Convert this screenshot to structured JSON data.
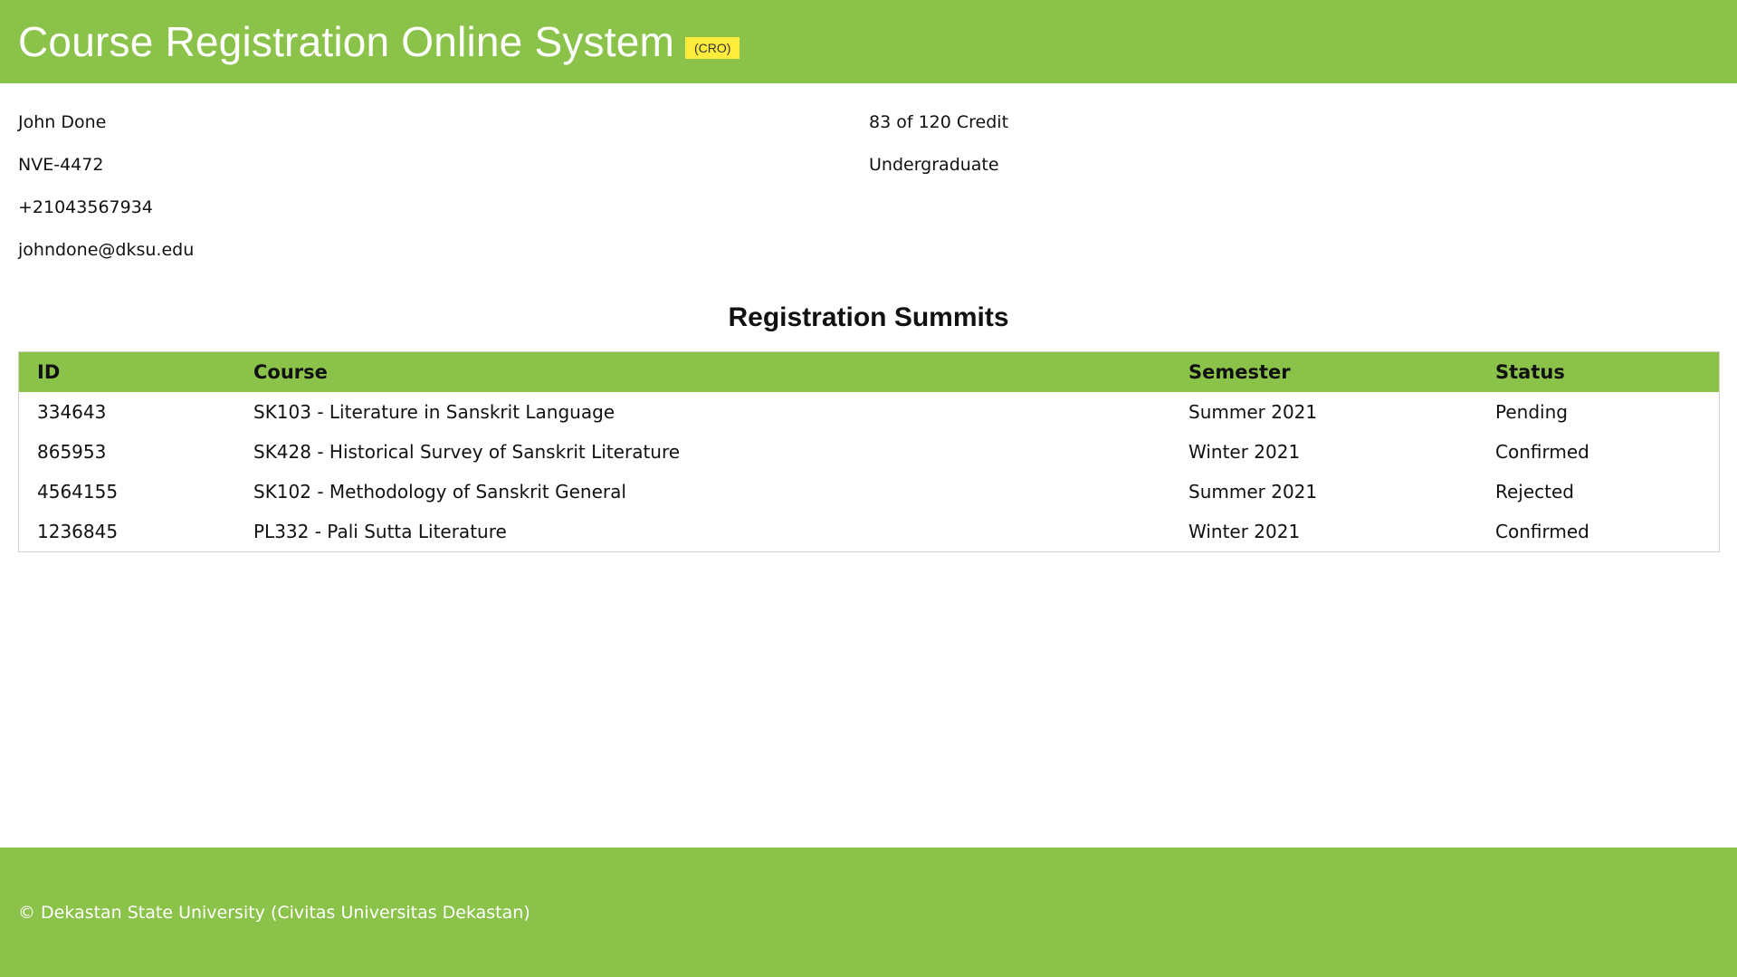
{
  "header": {
    "title": "Course Registration Online System",
    "badge": "(CRO)"
  },
  "student": {
    "name": "John Done",
    "id": "NVE-4472",
    "phone": "+21043567934",
    "email": "johndone@dksu.edu",
    "credit": "83 of 120 Credit",
    "level": "Undergraduate"
  },
  "registrations": {
    "title": "Registration Summits",
    "columns": [
      "ID",
      "Course",
      "Semester",
      "Status"
    ],
    "rows": [
      [
        "334643",
        "SK103 - Literature in Sanskrit Language",
        "Summer 2021",
        "Pending"
      ],
      [
        "865953",
        "SK428 - Historical Survey of Sanskrit Literature",
        "Winter 2021",
        "Confirmed"
      ],
      [
        "4564155",
        "SK102 - Methodology of Sanskrit General",
        "Summer 2021",
        "Rejected"
      ],
      [
        "1236845",
        "PL332 - Pali Sutta Literature",
        "Winter 2021",
        "Confirmed"
      ]
    ]
  },
  "footer": {
    "text": "© Dekastan State University (Civitas Universitas Dekastan)"
  },
  "colors": {
    "brand_green": "#8bc34a",
    "badge_yellow": "#ffeb3b"
  }
}
